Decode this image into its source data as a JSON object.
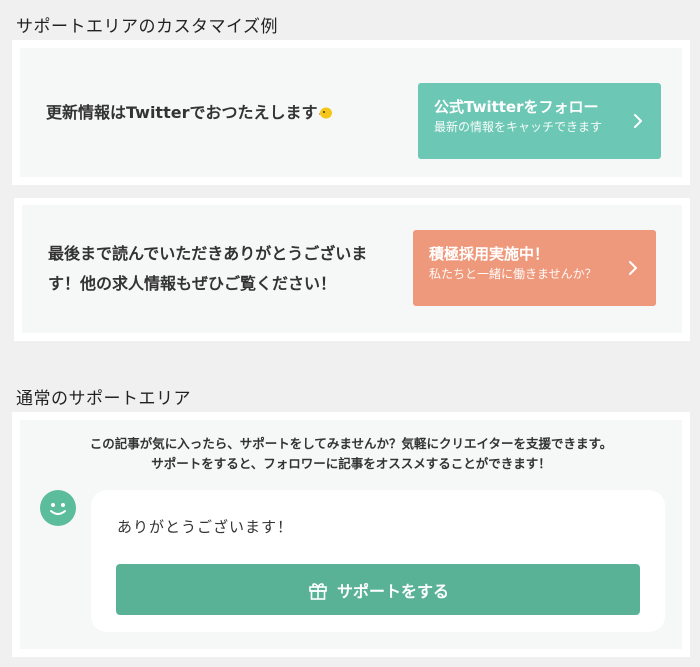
{
  "custom_section": {
    "heading": "サポートエリアのカスタマイズ例",
    "card1": {
      "message": "更新情報はTwitterでおつたえします",
      "button_title": "公式Twitterをフォロー",
      "button_subtitle": "最新の情報をキャッチできます",
      "button_color": "#6cc7b4"
    },
    "card2": {
      "message_line1": "最後まで読んでいただきありがとうございま",
      "message_line2": "す！他の求人情報もぜひご覧ください！",
      "button_title": "積極採用実施中！",
      "button_subtitle": "私たちと一緒に働きませんか？",
      "button_color": "#ef997c"
    }
  },
  "normal_section": {
    "heading": "通常のサポートエリア",
    "description_line1": "この記事が気に入ったら、サポートをしてみませんか？気軽にクリエイターを支援できます。",
    "description_line2": "サポートをすると、フォロワーに記事をオススメすることができます！",
    "thanks_message": "ありがとうございます！",
    "support_button_label": "サポートをする",
    "icons": [
      "smile-avatar-icon",
      "gift-icon",
      "chevron-right-icon",
      "chick-emoji-icon"
    ]
  }
}
